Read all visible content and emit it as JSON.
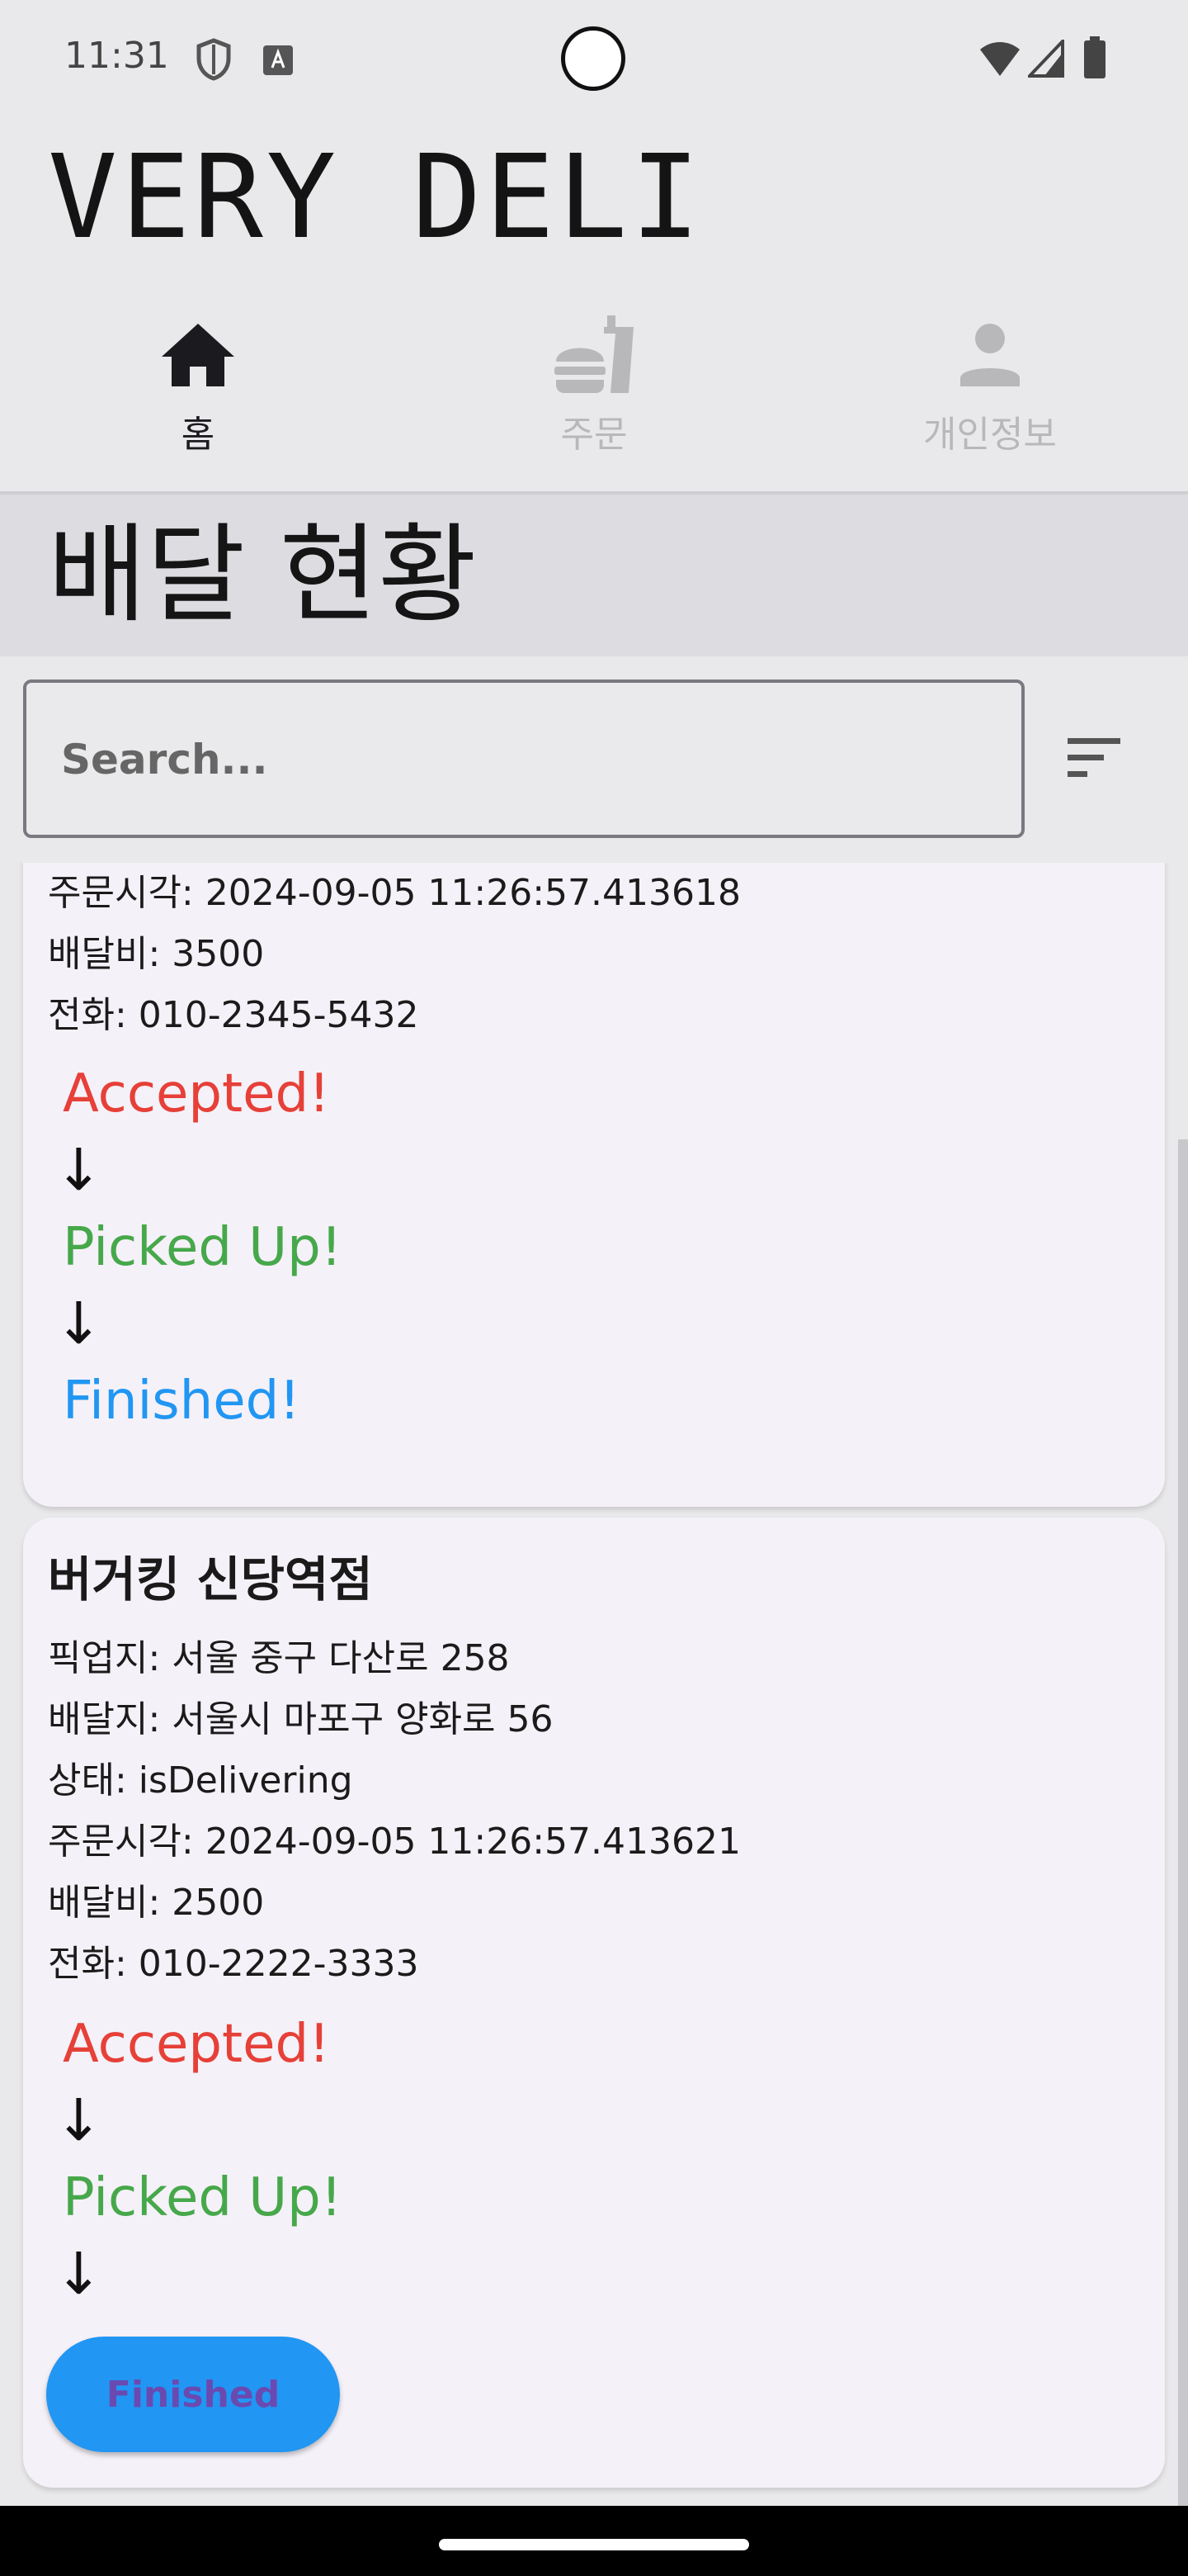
{
  "status_bar": {
    "time": "11:31"
  },
  "app": {
    "title": "VERY DELI"
  },
  "nav": {
    "tabs": [
      {
        "label": "홈",
        "icon": "home-icon",
        "active": true
      },
      {
        "label": "주문",
        "icon": "fastfood-icon",
        "active": false
      },
      {
        "label": "개인정보",
        "icon": "person-icon",
        "active": false
      }
    ]
  },
  "section": {
    "title": "배달 현황"
  },
  "search": {
    "placeholder": "Search..."
  },
  "orders": [
    {
      "order_time": "주문시각: 2024-09-05 11:26:57.413618",
      "fee": "배달비: 3500",
      "phone": "전화: 010-2345-5432",
      "steps": {
        "accepted": "Accepted!",
        "picked": "Picked Up!",
        "finished": "Finished!"
      }
    },
    {
      "name": "버거킹 신당역점",
      "pickup": "픽업지: 서울 중구 다산로 258",
      "destination": "배달지: 서울시 마포구 양화로 56",
      "status": "상태: isDelivering",
      "order_time": "주문시각: 2024-09-05 11:26:57.413621",
      "fee": "배달비: 2500",
      "phone": "전화: 010-2222-3333",
      "steps": {
        "accepted": "Accepted!",
        "picked": "Picked Up!",
        "finished_button": "Finished"
      }
    }
  ],
  "colors": {
    "accepted": "#e64038",
    "picked": "#46a84a",
    "finished": "#2196f3",
    "card_bg": "#f5f1f8"
  }
}
